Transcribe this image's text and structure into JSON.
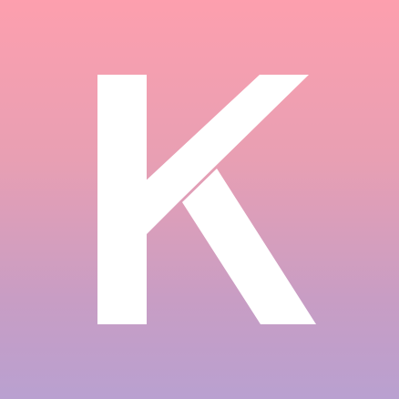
{
  "app_icon": {
    "letter": "K",
    "gradient_top": "#fd9fae",
    "gradient_bottom": "#b9a0d0",
    "letter_color": "#ffffff"
  }
}
